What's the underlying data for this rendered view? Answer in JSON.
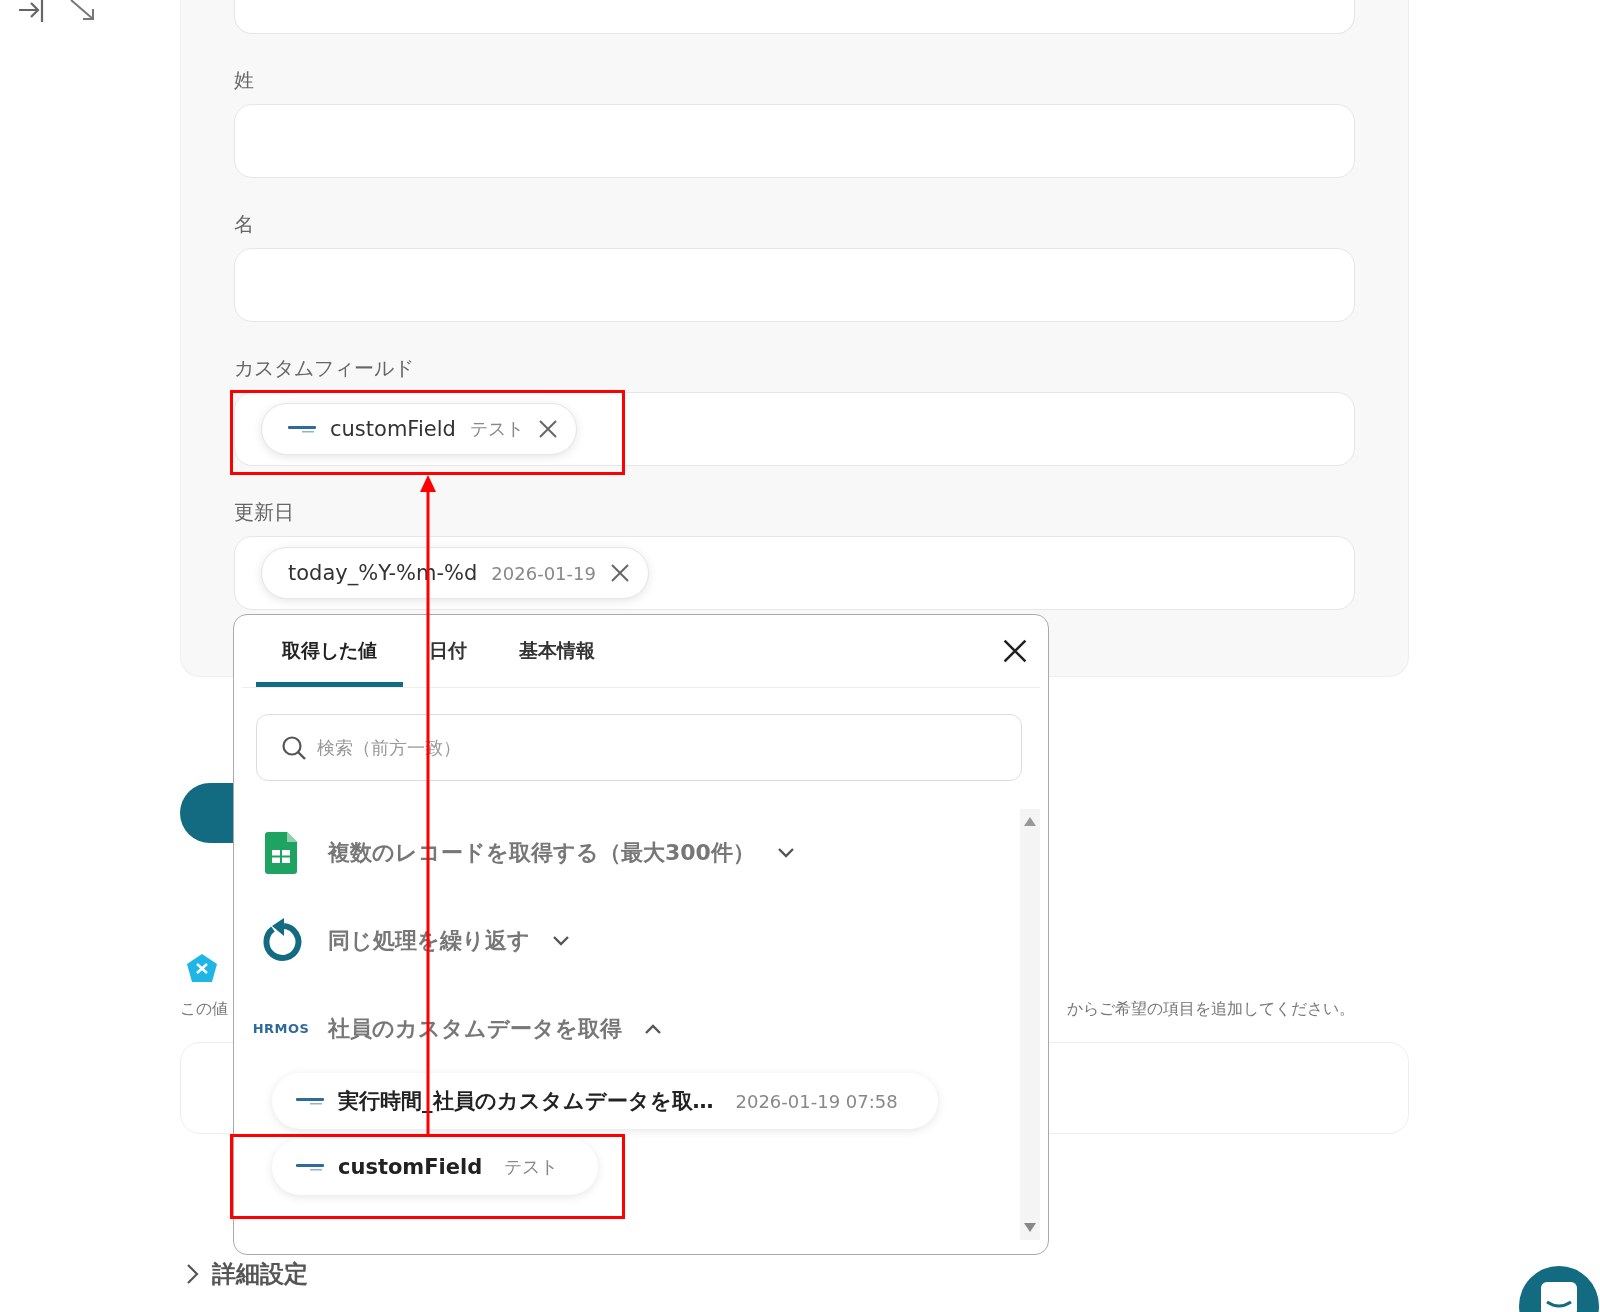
{
  "form": {
    "fields": [
      {
        "kind": "partial"
      },
      {
        "kind": "full",
        "label": "姓"
      },
      {
        "kind": "full",
        "label": "名"
      },
      {
        "kind": "full",
        "label": "カスタムフィールド",
        "chips": [
          {
            "kind": "hrmos",
            "name": "customField",
            "value": "テスト"
          }
        ]
      },
      {
        "kind": "full",
        "label": "更新日",
        "chips": [
          {
            "kind": "text",
            "name": "today_%Y-%m-%d",
            "value": "2026-01-19"
          }
        ]
      }
    ]
  },
  "popup": {
    "tabs": [
      {
        "label": "取得した値",
        "selected": true
      },
      {
        "label": "日付",
        "selected": false
      },
      {
        "label": "基本情報",
        "selected": false
      }
    ],
    "search": {
      "placeholder": "検索（前方一致）"
    },
    "groups": [
      {
        "kind": "sheets",
        "title": "複数のレコードを取得する（最大300件）",
        "expanded": false
      },
      {
        "kind": "loop",
        "title": "同じ処理を繰り返す",
        "expanded": false
      },
      {
        "kind": "hrmos",
        "logo": "HRMOS",
        "title": "社員のカスタムデータを取得",
        "expanded": true,
        "items": [
          {
            "kind": "hrmos",
            "name": "実行時間_社員のカスタムデータを取…",
            "value": "2026-01-19 07:58"
          },
          {
            "kind": "hrmos",
            "name": "customField",
            "value": "テスト"
          }
        ]
      }
    ]
  },
  "below": {
    "hint_start": "この値",
    "hint_end": "からご希望の項目を追加してください。",
    "advanced": {
      "label": "詳細設定",
      "expanded": false
    }
  }
}
